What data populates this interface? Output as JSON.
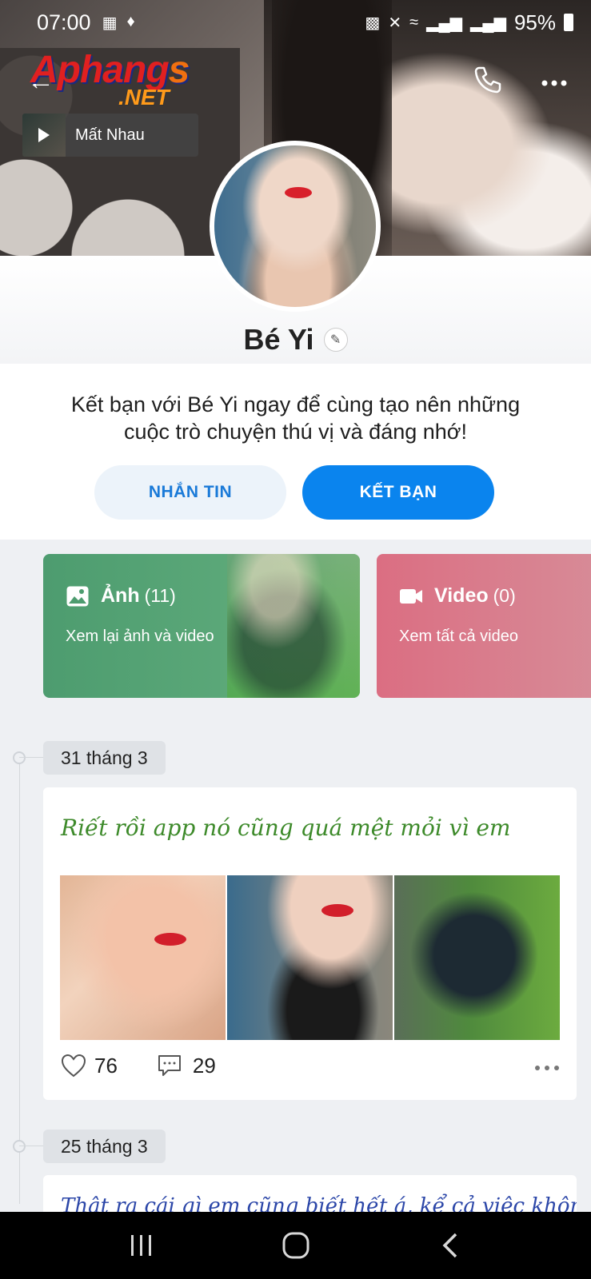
{
  "status_bar": {
    "time": "07:00",
    "battery_percent": "95%"
  },
  "header": {
    "logo_main": "Aphang",
    "logo_s": "s",
    "logo_net": ".NET"
  },
  "music": {
    "title": "Mất Nhau"
  },
  "profile": {
    "name": "Bé Yi",
    "invite_text": "Kết bạn với Bé Yi ngay để cùng tạo nên những cuộc trò chuyện thú vị và đáng nhớ!",
    "message_button": "NHẮN TIN",
    "add_friend_button": "KẾT BẠN"
  },
  "media": {
    "photos": {
      "title": "Ảnh",
      "count": "(11)",
      "subtitle": "Xem lại ảnh và video"
    },
    "videos": {
      "title": "Video",
      "count": "(0)",
      "subtitle": "Xem tất cả video"
    }
  },
  "timeline": [
    {
      "date": "31 tháng 3",
      "caption": "Riết rồi app nó cũng quá mệt mỏi vì em",
      "likes": "76",
      "comments": "29"
    },
    {
      "date": "25 tháng 3",
      "caption": "Thật ra cái gì em cũng biết hết á, kể cả việc không ai yêu"
    }
  ],
  "colors": {
    "primary_blue": "#0a84ee",
    "photo_card": "#4d9c6f",
    "video_card": "#db6e82",
    "caption_green": "#3d8a2a",
    "caption_blue": "#2b46a8"
  }
}
